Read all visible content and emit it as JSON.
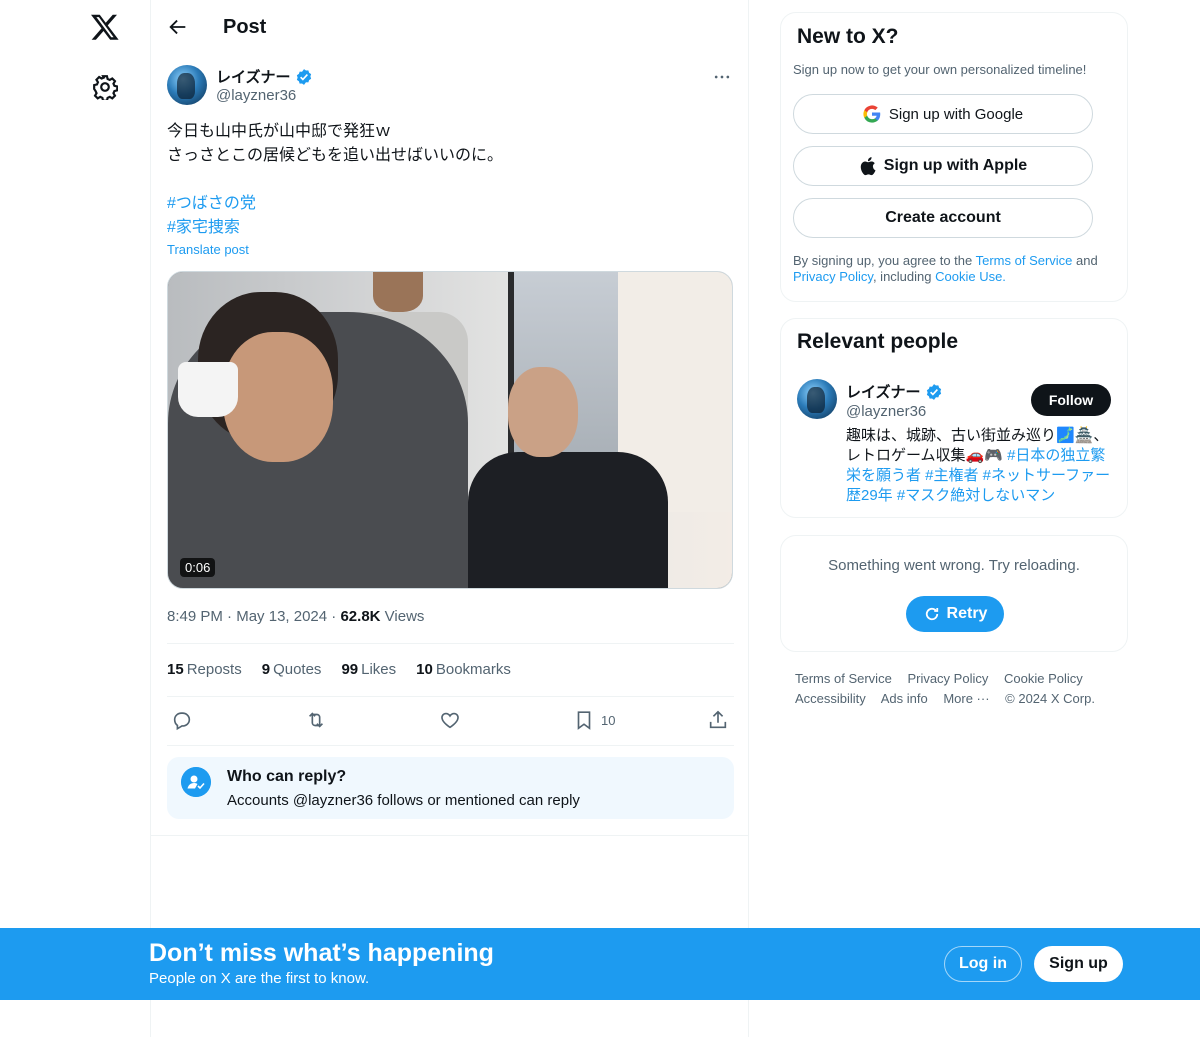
{
  "header": {
    "title": "Post"
  },
  "tweet": {
    "author_name": "レイズナー",
    "author_handle": "@layzner36",
    "lines": [
      "今日も山中氏が山中邸で発狂ｗ",
      "さっさとこの居候どもを追い出せばいいのに。"
    ],
    "hashtags": [
      "#つばさの党",
      "#家宅捜索"
    ],
    "translate": "Translate post",
    "video_duration": "0:06",
    "time": "8:49 PM",
    "date": "May 13, 2024",
    "views_count": "62.8K",
    "views_label": "Views",
    "reposts_count": "15",
    "reposts_label": "Reposts",
    "quotes_count": "9",
    "quotes_label": "Quotes",
    "likes_count": "99",
    "likes_label": "Likes",
    "bookmarks_count": "10",
    "bookmarks_label": "Bookmarks",
    "bookmark_action_count": "10",
    "who_can_reply_title": "Who can reply?",
    "who_can_reply_text": "Accounts @layzner36 follows or mentioned can reply"
  },
  "signup_card": {
    "title": "New to X?",
    "subtitle": "Sign up now to get your own personalized timeline!",
    "google_label": "Sign up with Google",
    "apple_label": "Sign up with Apple",
    "create_label": "Create account",
    "legal_prefix": "By signing up, you agree to the ",
    "terms": "Terms of Service",
    "and": " and ",
    "privacy": "Privacy Policy",
    "including": ", including ",
    "cookie": "Cookie Use."
  },
  "relevant": {
    "title": "Relevant people",
    "name": "レイズナー",
    "handle": "@layzner36",
    "follow_label": "Follow",
    "bio_text": "趣味は、城跡、古い街並み巡り🗾🏯、レトロゲーム収集🚗🎮 ",
    "bio_tags": "#日本の独立繁栄を願う者 #主権者 #ネットサーファー歴29年 #マスク絶対しないマン"
  },
  "error_card": {
    "message": "Something went wrong. Try reloading.",
    "retry_label": "Retry"
  },
  "footer": {
    "links": [
      "Terms of Service",
      "Privacy Policy",
      "Cookie Policy",
      "Accessibility",
      "Ads info",
      "More ···",
      "© 2024 X Corp."
    ]
  },
  "banner": {
    "title": "Don’t miss what’s happening",
    "subtitle": "People on X are the first to know.",
    "login_label": "Log in",
    "signup_label": "Sign up"
  },
  "colors": {
    "accent": "#1d9bf0",
    "text": "#0f1419",
    "muted": "#536471"
  }
}
